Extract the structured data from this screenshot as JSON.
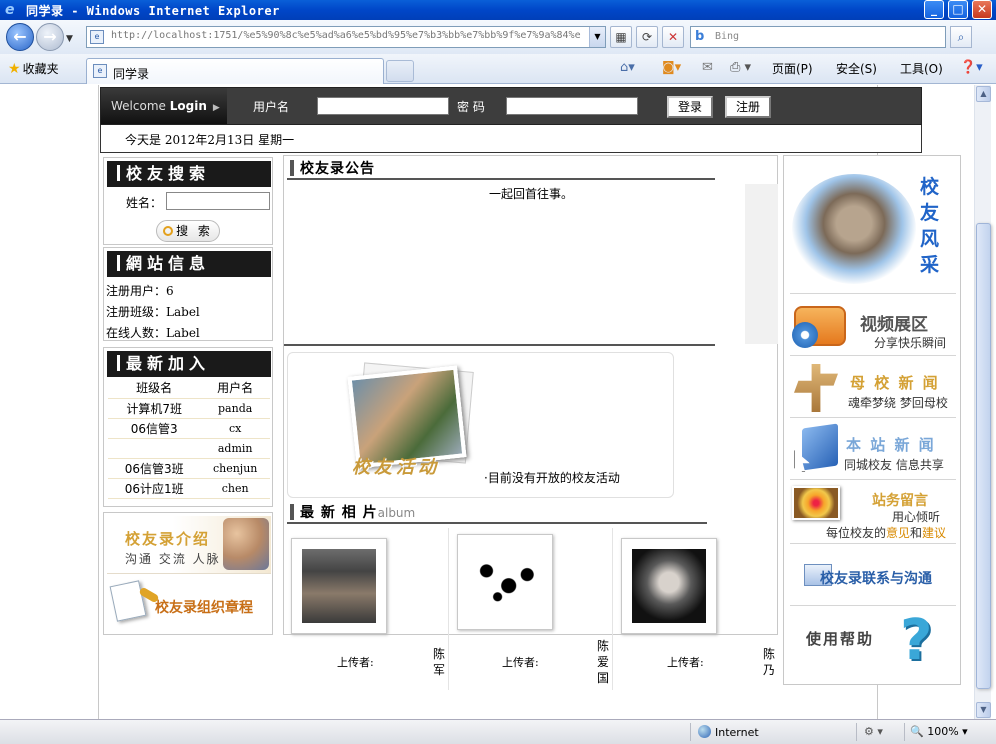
{
  "window": {
    "title": "同学录 - Windows Internet Explorer"
  },
  "address": {
    "url": "http://localhost:1751/%e5%90%8c%e5%ad%a6%e5%bd%95%e7%b3%bb%e7%bb%9f%e7%9a%84%e8",
    "search_placeholder": "Bing"
  },
  "tabs": {
    "favorites_label": "收藏夹",
    "active_tab": "同学录"
  },
  "commands": {
    "page": "页面(P)",
    "safety": "安全(S)",
    "tools": "工具(O)"
  },
  "login": {
    "welcome": "Welcome",
    "welcome_bold": "Login",
    "username_label": "用户名",
    "password_label": "密 码",
    "login_button": "登录",
    "register_button": "注册"
  },
  "date_text": "今天是 2012年2月13日 星期一",
  "search_box": {
    "title": "校友搜索",
    "name_label": "姓名：",
    "button": "搜 索"
  },
  "site_info": {
    "title": "網站信息",
    "rows": [
      {
        "label": "注册用户：",
        "value": "6"
      },
      {
        "label": "注册班级：",
        "value": "Label"
      },
      {
        "label": "在线人数：",
        "value": "Label"
      }
    ]
  },
  "new_join": {
    "title": "最新加入",
    "headers": [
      "班级名",
      "用户名"
    ],
    "rows": [
      [
        "计算机7班",
        "panda"
      ],
      [
        "06信管3",
        "cx"
      ],
      [
        "",
        "admin"
      ],
      [
        "06信管3班",
        "chenjun"
      ],
      [
        "06计应1班",
        "chen"
      ]
    ]
  },
  "intro": {
    "title": "校友录介绍",
    "subtitle": "沟通 交流 人脉",
    "charter": "校友录组织章程"
  },
  "notice": {
    "title": "校友录公告",
    "text": "一起回首往事。"
  },
  "activity": {
    "word": "校友活动",
    "message": "·目前没有开放的校友活动"
  },
  "album": {
    "title": "最 新 相 片",
    "title_suffix": "album",
    "items": [
      {
        "uploader_label": "上传者:",
        "name": "陈军"
      },
      {
        "uploader_label": "上传者:",
        "name": "陈爱国"
      },
      {
        "uploader_label": "上传者:",
        "name": "陈乃"
      }
    ]
  },
  "right_menu": {
    "campus": "校友风采",
    "video_title": "视频展区",
    "video_sub": "分享快乐瞬间",
    "school_news_title": "母 校 新 闻",
    "school_news_sub": "魂牵梦绕 梦回母校",
    "site_news_title": "本 站 新 闻",
    "site_news_sub": "同城校友 信息共享",
    "guestbook_title": "站务留言",
    "guestbook_sub1": "用心倾听",
    "guestbook_sub2a": "每位校友的",
    "guestbook_sub2b": "意见",
    "guestbook_sub2c": "和",
    "guestbook_sub2d": "建议",
    "contact": "校友录联系与沟通",
    "help": "使用帮助"
  },
  "status": {
    "zone": "Internet",
    "zoom": "100%"
  },
  "colors": {
    "title_bar": "#0046c8",
    "login_bar": "#3d3d3d",
    "accent_gold": "#d4a135",
    "accent_blue": "#2a5fa8"
  }
}
